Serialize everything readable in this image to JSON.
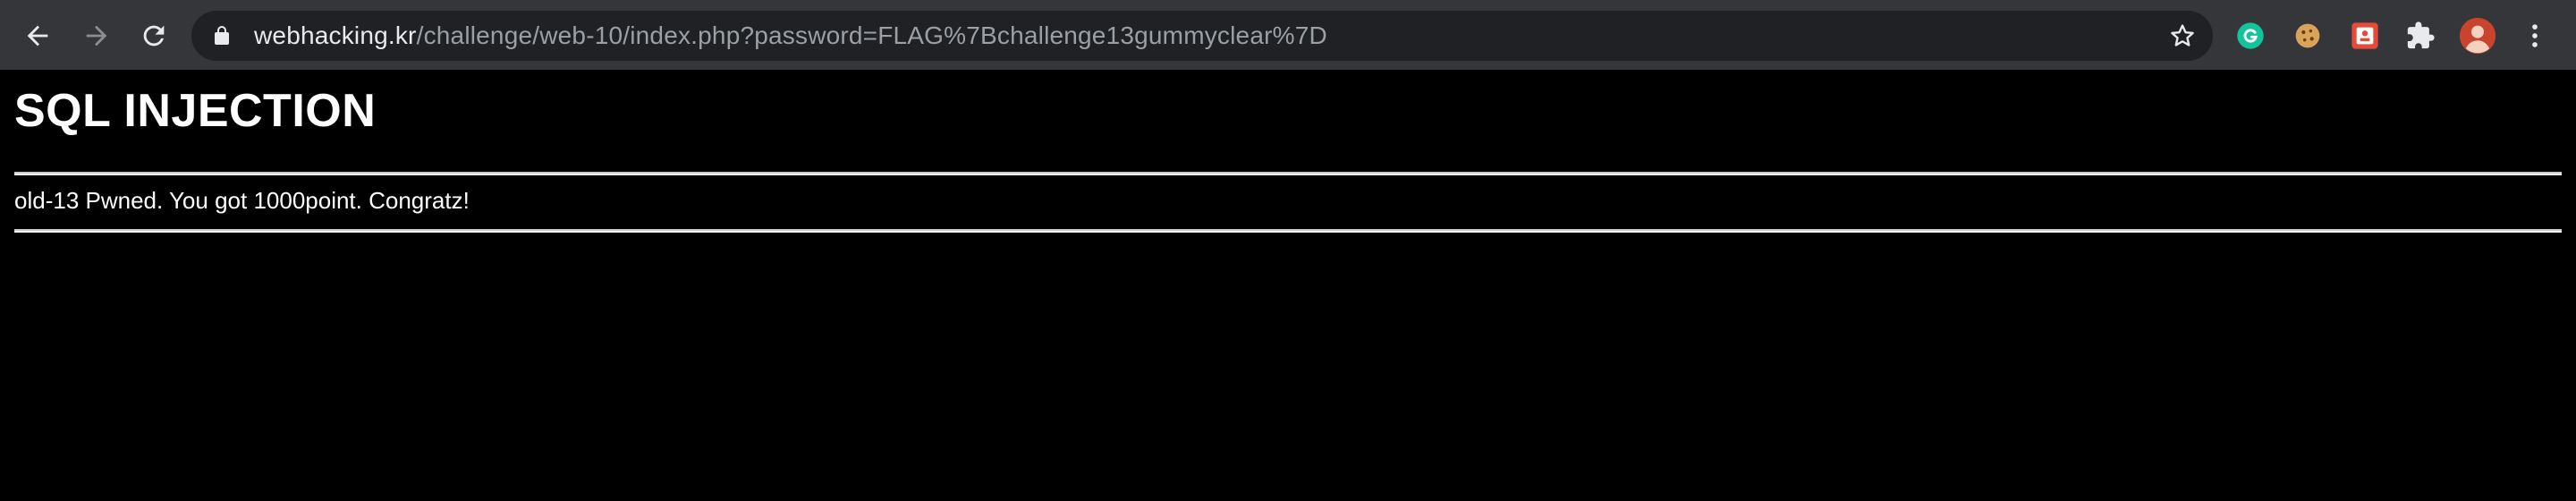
{
  "browser": {
    "url_host": "webhacking.kr",
    "url_path": "/challenge/web-10/index.php?password=FLAG%7Bchallenge13gummyclear%7D",
    "icons": [
      "back-arrow-icon",
      "forward-arrow-icon",
      "reload-icon",
      "lock-icon",
      "bookmark-star-icon",
      "grammarly-icon",
      "cookie-icon",
      "extension-red-icon",
      "puzzle-icon",
      "avatar",
      "more-vert-icon"
    ],
    "colors": {
      "toolbar": "#35363a",
      "omnibox": "#202124",
      "host_text": "#e8eaed",
      "path_text": "#9aa0a6",
      "grammarly": "#15c39a",
      "avatar": "#c8442c"
    }
  },
  "page": {
    "title": "SQL INJECTION",
    "message": "old-13 Pwned. You got 1000point. Congratz!",
    "background": "#000000",
    "text_color": "#ffffff"
  }
}
